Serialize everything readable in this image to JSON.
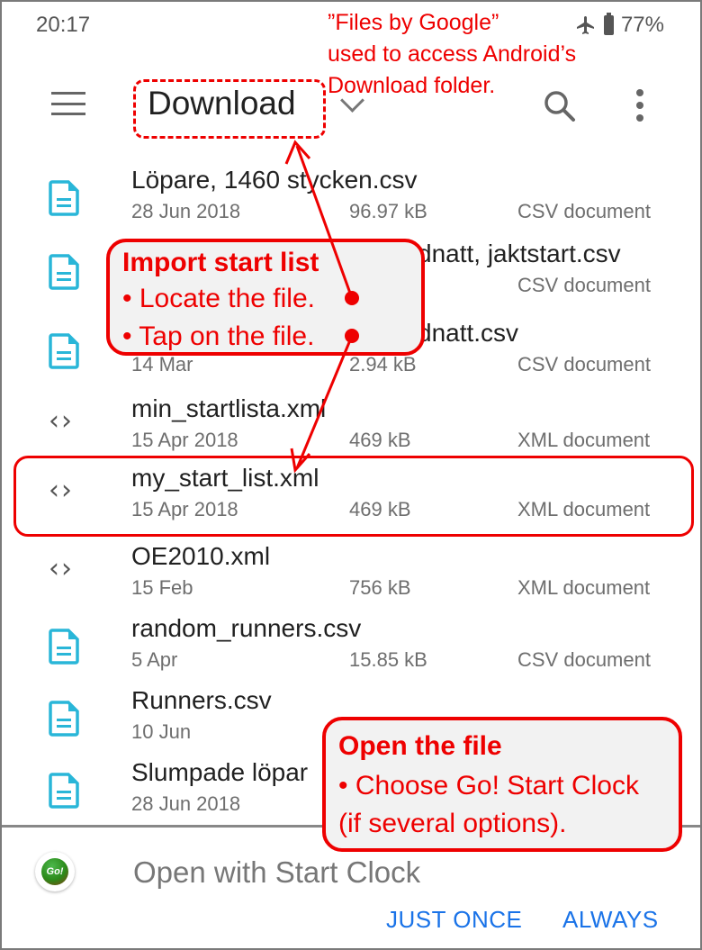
{
  "status_bar": {
    "time": "20:17",
    "battery": "77%",
    "airplane_icon": "airplane-icon",
    "battery_icon": "battery-icon"
  },
  "toolbar": {
    "title": "Download",
    "menu_icon": "hamburger-icon",
    "dropdown_icon": "chevron-down-icon",
    "search_icon": "search-icon",
    "more_icon": "more-vert-icon"
  },
  "files": [
    {
      "name": "Löpare, 1460 stycken.csv",
      "date": "28 Jun 2018",
      "size": "96.97 kB",
      "type": "CSV document",
      "icon": "csv-file-icon"
    },
    {
      "name": "dnatt, jaktstart.csv",
      "date": "",
      "size": "",
      "type": "CSV document",
      "icon": "csv-file-icon"
    },
    {
      "name": "dnatt.csv",
      "date": "14 Mar",
      "size": "2.94 kB",
      "type": "CSV document",
      "icon": "csv-file-icon"
    },
    {
      "name": "min_startlista.xml",
      "date": "15 Apr 2018",
      "size": "469 kB",
      "type": "XML document",
      "icon": "xml-file-icon"
    },
    {
      "name": "my_start_list.xml",
      "date": "15 Apr 2018",
      "size": "469 kB",
      "type": "XML document",
      "icon": "xml-file-icon"
    },
    {
      "name": "OE2010.xml",
      "date": "15 Feb",
      "size": "756 kB",
      "type": "XML document",
      "icon": "xml-file-icon"
    },
    {
      "name": "random_runners.csv",
      "date": "5 Apr",
      "size": "15.85 kB",
      "type": "CSV document",
      "icon": "csv-file-icon"
    },
    {
      "name": "Runners.csv",
      "date": "10 Jun",
      "size": "",
      "type": "",
      "icon": "csv-file-icon"
    },
    {
      "name": "Slumpade löpar",
      "date": "28 Jun 2018",
      "size": "",
      "type": "",
      "icon": "csv-file-icon"
    }
  ],
  "bottom_sheet": {
    "title": "Open with Start Clock",
    "app_icon_text": "Go!",
    "just_once": "JUST ONCE",
    "always": "ALWAYS"
  },
  "annotations": {
    "top_note": [
      "”Files by Google”",
      "used to access Android’s",
      "Download folder."
    ],
    "import_callout": {
      "heading": "Import start list",
      "lines": [
        "• Locate the file.",
        "• Tap on the file."
      ]
    },
    "open_callout": {
      "heading": "Open the file",
      "lines": [
        "• Choose Go! Start Clock",
        "(if several options)."
      ]
    }
  },
  "colors": {
    "accent": "#1a73e8",
    "annotation": "#ee0000",
    "csv_icon": "#29b6d8"
  }
}
